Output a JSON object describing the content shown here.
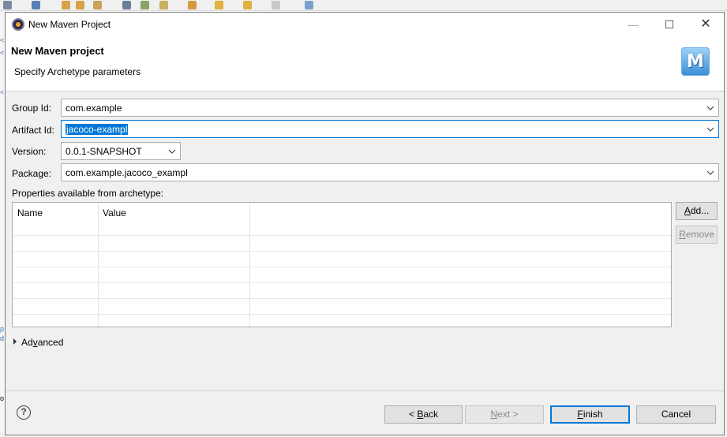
{
  "window": {
    "title": "New Maven Project",
    "minimize_glyph": "—",
    "maximize_glyph": "☐",
    "close_glyph": "✕"
  },
  "header": {
    "title": "New Maven project",
    "subtitle": "Specify Archetype parameters",
    "logo_letter": "M"
  },
  "form": {
    "group_id": {
      "label": "Group Id:",
      "value": "com.example"
    },
    "artifact_id": {
      "label": "Artifact Id:",
      "value": "jacoco-exampl"
    },
    "version": {
      "label": "Version:",
      "value": "0.0.1-SNAPSHOT"
    },
    "package": {
      "label": "Package:",
      "value": "com.example.jacoco_exampl"
    }
  },
  "properties": {
    "label": "Properties available from archetype:",
    "columns": [
      "Name",
      "Value"
    ],
    "rows": [],
    "add_button": {
      "prefix": "",
      "mnemonic": "A",
      "suffix": "dd..."
    },
    "remove_button": {
      "prefix": "",
      "mnemonic": "R",
      "suffix": "emove"
    }
  },
  "advanced": {
    "label_mnemonic": "v",
    "label_prefix": "Ad",
    "label_suffix": "anced"
  },
  "footer": {
    "help_icon": "?",
    "back_button": {
      "prefix": "< ",
      "mnemonic": "B",
      "suffix": "ack"
    },
    "next_button": {
      "prefix": "",
      "mnemonic": "N",
      "suffix": "ext >"
    },
    "finish_button": {
      "prefix": "",
      "mnemonic": "F",
      "suffix": "inish"
    },
    "cancel_button": "Cancel"
  },
  "colors": {
    "selection": "#0078d7",
    "dialog_bg": "#f0f0f0",
    "focus_border": "#0078d7"
  }
}
